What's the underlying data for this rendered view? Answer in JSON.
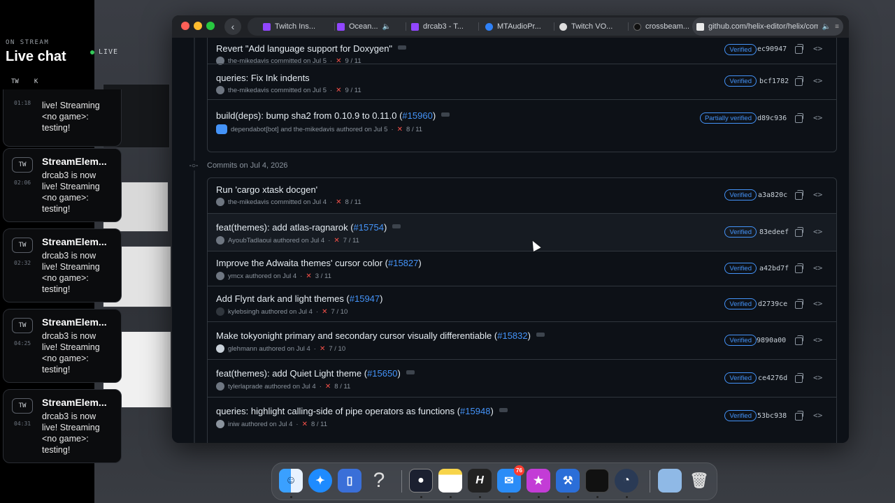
{
  "chat": {
    "eyebrow": "ON STREAM",
    "title": "Live chat",
    "live_label": "LIVE",
    "tabs": [
      "TW",
      "K"
    ],
    "messages": [
      {
        "badge": "TW",
        "author": "",
        "time": "01:18",
        "text": "live! Streaming <no game>: testing!"
      },
      {
        "badge": "TW",
        "author": "StreamElem...",
        "time": "02:06",
        "text": "drcab3 is now live! Streaming <no game>: testing!"
      },
      {
        "badge": "TW",
        "author": "StreamElem...",
        "time": "02:32",
        "text": "drcab3 is now live! Streaming <no game>: testing!"
      },
      {
        "badge": "TW",
        "author": "StreamElem...",
        "time": "04:25",
        "text": "drcab3 is now live! Streaming <no game>: testing!"
      },
      {
        "badge": "TW",
        "author": "StreamElem...",
        "time": "04:31",
        "text": "drcab3 is now live! Streaming <no game>: testing!"
      }
    ]
  },
  "browser": {
    "tabs": [
      {
        "label": "Twitch Ins...",
        "icon": "twitch-icon"
      },
      {
        "label": "Ocean...",
        "icon": "twitch-icon"
      },
      {
        "label": "drcab3 - T...",
        "icon": "twitch-icon"
      },
      {
        "label": "MTAudioPr...",
        "icon": "mt-icon"
      },
      {
        "label": "Twitch VO...",
        "icon": "github-icon"
      },
      {
        "label": "crossbeam...",
        "icon": "github-icon"
      },
      {
        "label": "github.com/helix-editor/helix/com",
        "icon": "page-icon"
      }
    ]
  },
  "commits_top": [
    {
      "title": "Revert \"Add language support for Doxygen\"",
      "pr": "",
      "author": "the-mikedavis committed on Jul 5",
      "checks": "9 / 11",
      "badge": "Verified",
      "sha": "ec90947",
      "more": true
    },
    {
      "title": "queries: Fix Ink indents",
      "pr": "",
      "author": "the-mikedavis committed on Jul 5",
      "checks": "9 / 11",
      "badge": "Verified",
      "sha": "bcf1782",
      "more": false
    },
    {
      "title": "build(deps): bump sha2 from 0.10.9 to 0.11.0 (",
      "pr": "#15960",
      "author": "dependabot[bot] and the-mikedavis authored on Jul 5",
      "checks": "8 / 11",
      "badge": "Partially verified",
      "sha": "d89c936",
      "more": true
    }
  ],
  "group_header": "Commits on Jul 4, 2026",
  "commits_bottom": [
    {
      "title": "Run 'cargo xtask docgen'",
      "pr": "",
      "author": "the-mikedavis committed on Jul 4",
      "checks": "8 / 11",
      "badge": "Verified",
      "sha": "a3a820c",
      "more": false
    },
    {
      "title": "feat(themes): add atlas-ragnarok (",
      "pr": "#15754",
      "author": "AyoubTadlaoui authored on Jul 4",
      "checks": "7 / 11",
      "badge": "Verified",
      "sha": "83edeef",
      "more": true
    },
    {
      "title": "Improve the Adwaita themes' cursor color (",
      "pr": "#15827",
      "author": "ymcx authored on Jul 4",
      "checks": "3 / 11",
      "badge": "Verified",
      "sha": "a42bd7f",
      "more": false
    },
    {
      "title": "Add Flynt dark and light themes (",
      "pr": "#15947",
      "author": "kylebsingh authored on Jul 4",
      "checks": "7 / 10",
      "badge": "Verified",
      "sha": "d2739ce",
      "more": false
    },
    {
      "title": "Make tokyonight primary and secondary cursor visually differentiable (",
      "pr": "#15832",
      "author": "glehmann authored on Jul 4",
      "checks": "7 / 10",
      "badge": "Verified",
      "sha": "9890a00",
      "more": true
    },
    {
      "title": "feat(themes): add Quiet Light theme (",
      "pr": "#15650",
      "author": "tylerlaprade authored on Jul 4",
      "checks": "8 / 11",
      "badge": "Verified",
      "sha": "ce4276d",
      "more": true
    },
    {
      "title": "queries: highlight calling-side of pipe operators as functions (",
      "pr": "#15948",
      "author": "iniw authored on Jul 4",
      "checks": "8 / 11",
      "badge": "Verified",
      "sha": "53bc938",
      "more": true
    }
  ],
  "dock": {
    "mail_badge": "76",
    "apps": [
      "finder",
      "safari",
      "simulator",
      "help",
      "obs",
      "notes",
      "helix",
      "mail",
      "itunes-store",
      "xcode",
      "activity-monitor",
      "instruments",
      "downloads",
      "trash"
    ]
  },
  "colors": {
    "accent": "#4493f8",
    "fail": "#f85149",
    "bg": "#0d1117"
  }
}
